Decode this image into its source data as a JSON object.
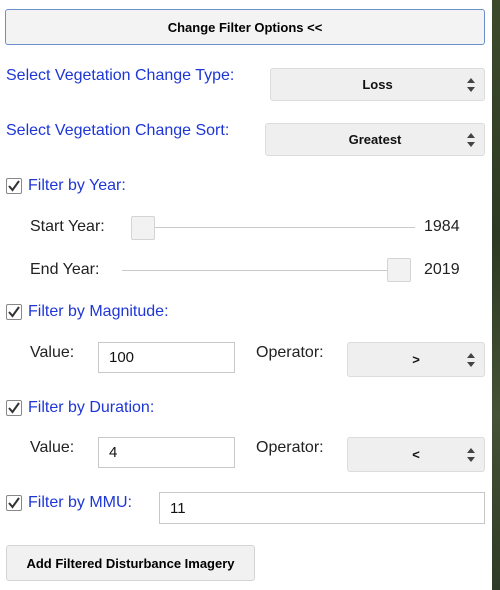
{
  "toggle_button": {
    "label": "Change Filter Options <<"
  },
  "change_type": {
    "label": "Select Vegetation Change Type:",
    "value": "Loss"
  },
  "change_sort": {
    "label": "Select Vegetation Change Sort:",
    "value": "Greatest"
  },
  "filter_year": {
    "label": "Filter by Year:",
    "checked": true,
    "start_label": "Start Year:",
    "start_value": "1984",
    "end_label": "End Year:",
    "end_value": "2019",
    "start_fraction": 0.0,
    "end_fraction": 1.0
  },
  "filter_magnitude": {
    "label": "Filter by Magnitude:",
    "checked": true,
    "value_label": "Value:",
    "value": "100",
    "operator_label": "Operator:",
    "operator": ">"
  },
  "filter_duration": {
    "label": "Filter by Duration:",
    "checked": true,
    "value_label": "Value:",
    "value": "4",
    "operator_label": "Operator:",
    "operator": "<"
  },
  "filter_mmu": {
    "label": "Filter by MMU:",
    "checked": true,
    "value": "11"
  },
  "add_button": {
    "label": "Add Filtered Disturbance Imagery"
  },
  "colors": {
    "label_blue": "#1e36d6",
    "button_bg": "#f1f1f1",
    "button_border_primary": "#6b8fc9"
  },
  "icons": {
    "checkbox": "checkmark-icon",
    "select_arrows": "up-down-arrows-icon"
  }
}
